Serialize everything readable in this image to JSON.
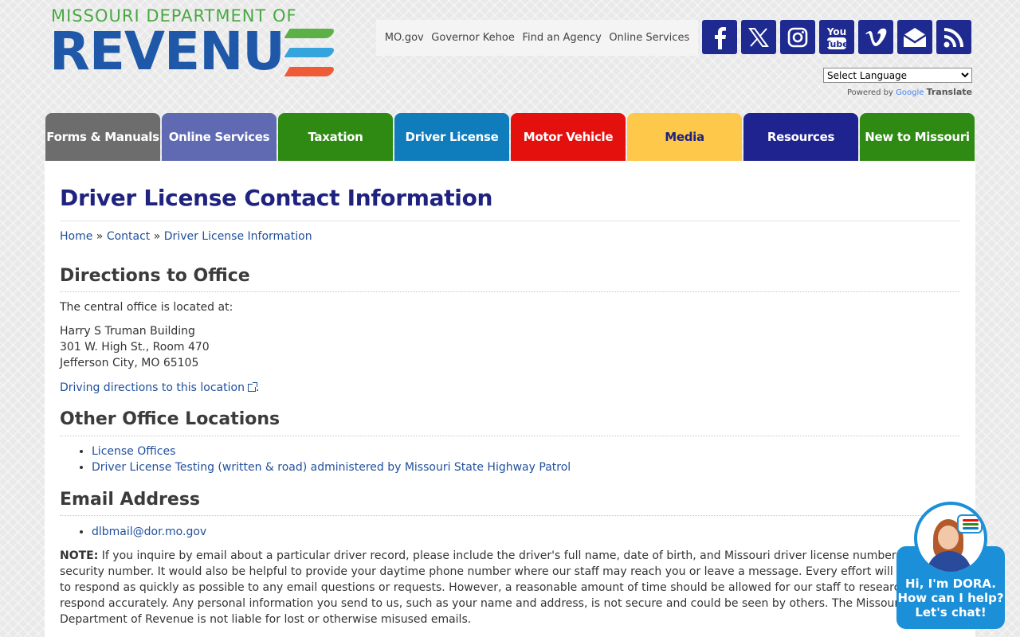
{
  "logo": {
    "top_text": "MISSOURI DEPARTMENT OF",
    "main_text": "REVENU"
  },
  "top_links": [
    "MO.gov",
    "Governor Kehoe",
    "Find an Agency",
    "Online Services"
  ],
  "social": [
    "facebook-icon",
    "x-icon",
    "instagram-icon",
    "youtube-icon",
    "vimeo-icon",
    "email-icon",
    "rss-icon"
  ],
  "translate": {
    "select_label": "Select Language",
    "powered_by": "Powered by",
    "google": "Google",
    "translate": "Translate"
  },
  "nav": [
    {
      "label": "Forms & Manuals",
      "color": "#6d6d6d"
    },
    {
      "label": "Online Services",
      "color": "#5f6ab2"
    },
    {
      "label": "Taxation",
      "color": "#2e8a12"
    },
    {
      "label": "Driver License",
      "color": "#0f7cbc"
    },
    {
      "label": "Motor Vehicle",
      "color": "#e4100e"
    },
    {
      "label": "Media",
      "color": "#fec84a",
      "text_color": "#1f237f"
    },
    {
      "label": "Resources",
      "color": "#1f2390"
    },
    {
      "label": "New to Missouri",
      "color": "#2e8a12"
    }
  ],
  "page": {
    "title": "Driver License Contact Information",
    "breadcrumb": [
      "Home",
      "Contact",
      "Driver License Information"
    ],
    "breadcrumb_sep": "»"
  },
  "sections": {
    "directions": {
      "heading": "Directions to Office",
      "intro": "The central office is located at:",
      "address": [
        "Harry S Truman Building",
        "301 W. High St., Room 470",
        "Jefferson City, MO 65105"
      ],
      "link": "Driving directions to this location",
      "link_suffix": "."
    },
    "other": {
      "heading": "Other Office Locations",
      "items": [
        "License Offices",
        "Driver License Testing (written & road) administered by Missouri State Highway Patrol"
      ]
    },
    "email": {
      "heading": "Email Address",
      "items": [
        "dlbmail@dor.mo.gov"
      ],
      "note_label": "NOTE:",
      "note_text": " If you inquire by email about a particular driver record, please include the driver's full name, date of birth, and Missouri driver license number or social security number. It would also be helpful to provide your daytime phone number where our staff may reach you or leave a message. Every effort will be made to respond as quickly as possible to any email questions or requests. However, a reasonable amount of time should be allowed for our staff to research and respond accurately. Any personal information you send to us, such as your name and address, is not secure and could be seen by others. The Missouri Department of Revenue is not liable for lost or otherwise misused emails."
    }
  },
  "chat": {
    "line1": "Hi, I'm DORA.",
    "line2": "How can I help?",
    "line3": "Let's chat!"
  }
}
